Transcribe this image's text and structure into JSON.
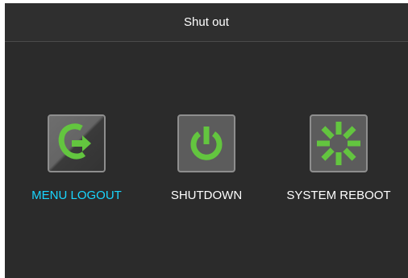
{
  "dialog": {
    "title": "Shut out"
  },
  "options": [
    {
      "label": "MENU LOGOUT",
      "icon": "logout-icon",
      "selected": true
    },
    {
      "label": "SHUTDOWN",
      "icon": "power-icon",
      "selected": false
    },
    {
      "label": "SYSTEM REBOOT",
      "icon": "reboot-icon",
      "selected": false
    }
  ],
  "colors": {
    "background": "#2b2b2b",
    "selected_label": "#19d6ff",
    "label": "#ffffff",
    "icon_green": "#63c53f"
  }
}
